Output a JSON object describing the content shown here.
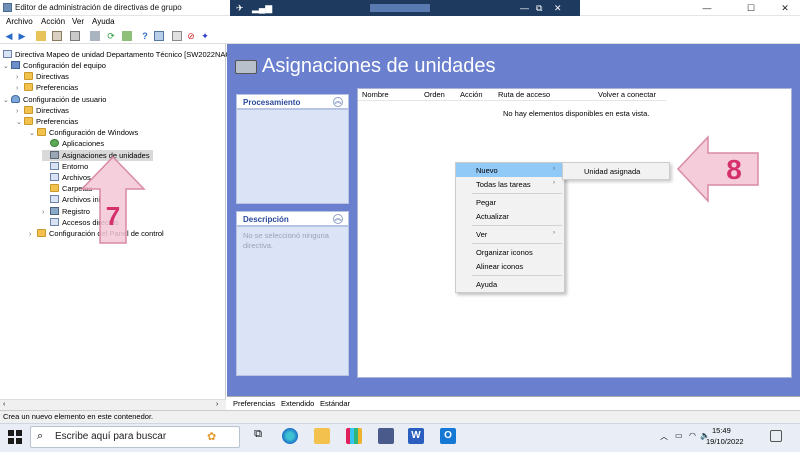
{
  "window": {
    "title": "Editor de administración de directivas de grupo",
    "min": "—",
    "max": "☐",
    "close": "✕"
  },
  "rdp": {
    "min": "—",
    "max": "⧉",
    "close": "✕"
  },
  "menu": [
    "Archivo",
    "Acción",
    "Ver",
    "Ayuda"
  ],
  "tree": {
    "root": "Directiva Mapeo de unidad Departamento Técnico [SW2022NAC",
    "computer": "Configuración del equipo",
    "c_policies": "Directivas",
    "c_prefs": "Preferencias",
    "user": "Configuración de usuario",
    "u_policies": "Directivas",
    "u_prefs": "Preferencias",
    "win_settings": "Configuración de Windows",
    "applications": "Aplicaciones",
    "drive_maps": "Asignaciones de unidades",
    "environment": "Entorno",
    "files": "Archivos",
    "folders": "Carpetas",
    "ini_files": "Archivos ini",
    "registry": "Registro",
    "shortcuts": "Accesos directos",
    "control_panel": "Configuración del Panel de control"
  },
  "right": {
    "title": "Asignaciones de unidades",
    "processing": "Procesamiento",
    "description": "Descripción",
    "description_text": "No se seleccionó ninguna directiva.",
    "columns": [
      "Nombre",
      "Orden",
      "Acción",
      "Ruta de acceso",
      "Volver a conectar"
    ],
    "empty": "No hay elementos disponibles en esta vista."
  },
  "context_menu": {
    "new": "Nuevo",
    "all_tasks": "Todas las tareas",
    "paste": "Pegar",
    "refresh": "Actualizar",
    "view": "Ver",
    "arrange": "Organizar iconos",
    "align": "Alinear iconos",
    "help": "Ayuda",
    "submenu_item": "Unidad asignada"
  },
  "tabs": [
    "Preferencias",
    "Extendido",
    "Estándar"
  ],
  "status": "Crea un nuevo elemento en este contenedor.",
  "taskbar": {
    "search_placeholder": "Escribe aquí para buscar",
    "time": "15:49",
    "date": "19/10/2022"
  },
  "callouts": {
    "step7": "7",
    "step8": "8"
  },
  "colors": {
    "pane_blue": "#6a7fce",
    "panel_title": "#2a4a9c",
    "menu_highlight": "#91c9f7",
    "callout_pink": "#f3c7d6",
    "callout_text": "#d5306c"
  }
}
